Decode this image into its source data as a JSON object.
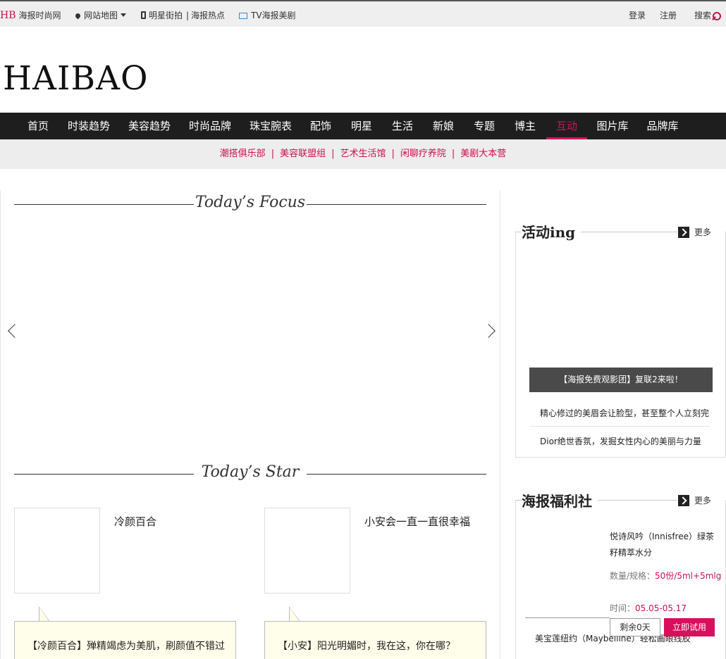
{
  "topbar": {
    "brand_mark": "HB",
    "brand_text": "海报时尚网",
    "sitemap": "网站地图",
    "street_snap": "明星街拍",
    "hot": "海报热点",
    "tv": "TV海报美剧",
    "login": "登录",
    "register": "注册",
    "search": "搜索"
  },
  "logo": "HAIBAO",
  "main_nav": [
    "首页",
    "时装趋势",
    "美容趋势",
    "时尚品牌",
    "珠宝腕表",
    "配饰",
    "明星",
    "生活",
    "新娘",
    "专题",
    "博主",
    "互动",
    "图片库",
    "品牌库"
  ],
  "main_nav_active": "互动",
  "sub_nav": [
    "潮搭俱乐部",
    "美容联盟组",
    "艺术生活馆",
    "闲聊疗养院",
    "美剧大本营"
  ],
  "focus": {
    "title": "Today’s Focus"
  },
  "star": {
    "title": "Today’s Star",
    "cards": [
      {
        "name": "冷颜百合",
        "quote": "【冷颜百合】殚精竭虑为美肌，刷颜值不错过"
      },
      {
        "name": "小安会一直一直很幸福",
        "quote": "【小安】阳光明媚时，我在这，你在哪？"
      }
    ]
  },
  "activity": {
    "title": "活动ing",
    "more": "更多",
    "banner": "【海报免费观影团】复联2来啦！",
    "items": [
      "精心修过的美眉会让脸型，甚至整个人立刻完",
      "Dior绝世香氛，发掘女性内心的美丽与力量"
    ]
  },
  "welfare": {
    "title": "海报福利社",
    "more": "更多",
    "product_name": "悦诗风吟（Innisfree）绿茶籽精萃水分",
    "qty_label": "数量/规格：",
    "qty_value": "50份/5ml+5mlg",
    "time_label": "时间：",
    "time_value": "05.05-05.17",
    "remaining": "剩余0天",
    "try_now": "立即试用",
    "next_item": "美宝莲纽约（Maybelline）轻松画眼线胶"
  },
  "colors": {
    "accent": "#d8105b",
    "nav_bg": "#1e1e1e",
    "tv_blue": "#2a8fd0"
  }
}
